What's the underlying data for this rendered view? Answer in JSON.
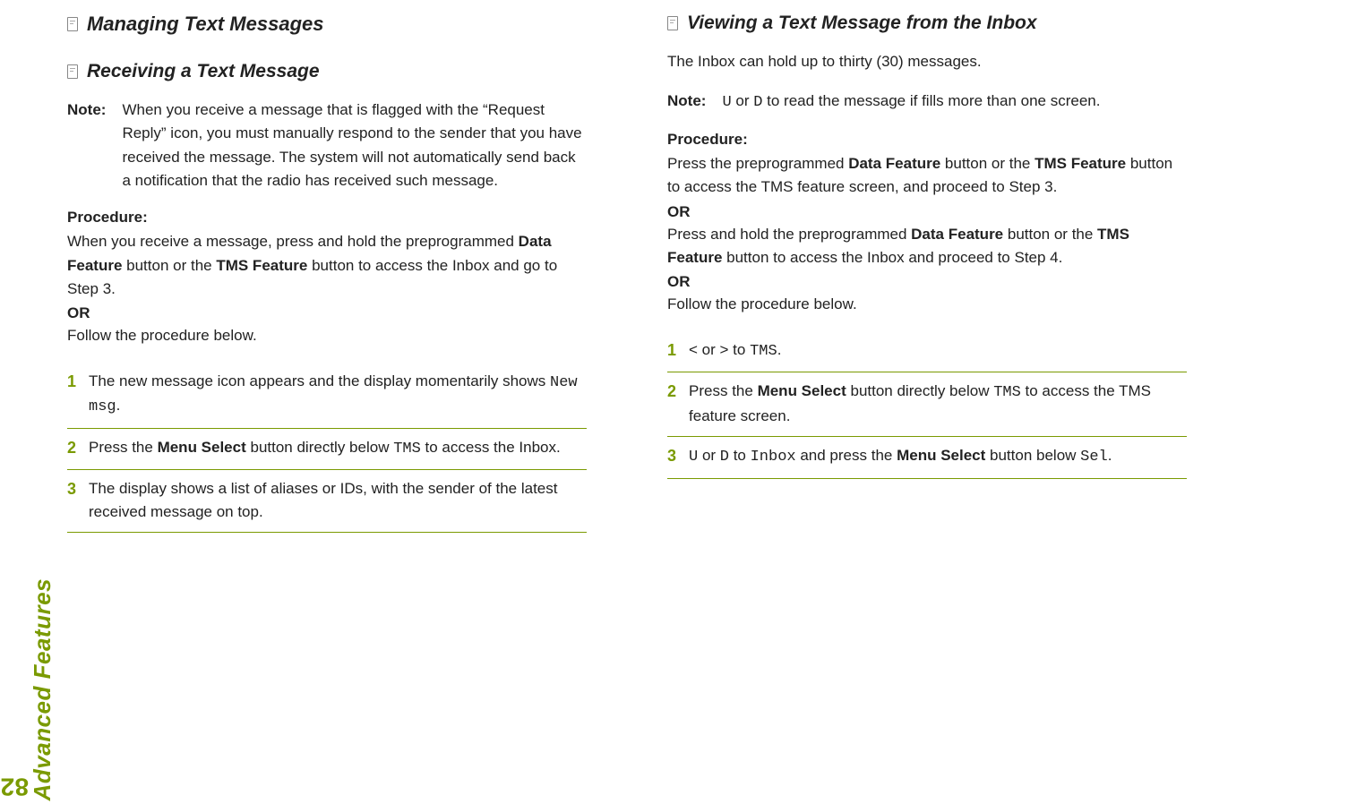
{
  "sidebar": {
    "label": "Advanced Features",
    "page": "82"
  },
  "left": {
    "heading1": "Managing Text Messages",
    "heading2": "Receiving a Text Message",
    "noteLabel": "Note:",
    "noteBody": "When you receive a message that is flagged with the “Request Reply” icon, you must manually respond to the sender that you have received the message. The system will not automatically send back a notification that the radio has received such message.",
    "procLabel": "Procedure:",
    "p1a": "When you receive a message, press and hold the preprogrammed ",
    "p1b": "Data Feature",
    "p1c": " button or the ",
    "p1d": "TMS Feature",
    "p1e": " button to access the Inbox and go to Step 3.",
    "or": "OR",
    "p2": "Follow the procedure below.",
    "step1a": "The new message icon appears and the display momentarily shows ",
    "step1b": "New msg",
    "step1c": ".",
    "step2a": "Press the ",
    "step2b": "Menu Select",
    "step2c": " button directly below ",
    "step2d": "TMS",
    "step2e": " to access the Inbox.",
    "step3": "The display shows a list of aliases or IDs, with the sender of the latest received message on top."
  },
  "right": {
    "heading2": "Viewing a Text Message from the Inbox",
    "intro": "The Inbox can hold up to thirty (30) messages.",
    "noteLabel": "Note:",
    "note_u": "U",
    "note_mid": " or ",
    "note_d": "D",
    "note_rest": " to read the message if fills more than one screen.",
    "procLabel": "Procedure:",
    "p1a": "Press the preprogrammed ",
    "p1b": "Data Feature",
    "p1c": " button or the ",
    "p1d": "TMS Feature",
    "p1e": " button to access the TMS feature screen, and proceed to Step 3.",
    "or": "OR",
    "p2a": "Press and hold the preprogrammed ",
    "p2b": "Data Feature",
    "p2c": " button or the ",
    "p2d": "TMS Feature",
    "p2e": " button to access the Inbox and proceed to Step 4.",
    "p3": "Follow the procedure below.",
    "s1a": "<",
    "s1b": " or ",
    "s1c": ">",
    "s1d": " to ",
    "s1e": "TMS",
    "s1f": ".",
    "s2a": "Press the ",
    "s2b": "Menu Select",
    "s2c": " button directly below ",
    "s2d": "TMS",
    "s2e": " to access the TMS feature screen.",
    "s3a": "U",
    "s3b": " or ",
    "s3c": "D",
    "s3d": " to ",
    "s3e": "Inbox",
    "s3f": " and press the ",
    "s3g": "Menu Select",
    "s3h": " button below ",
    "s3i": "Sel",
    "s3j": "."
  },
  "numbers": {
    "n1": "1",
    "n2": "2",
    "n3": "3"
  }
}
